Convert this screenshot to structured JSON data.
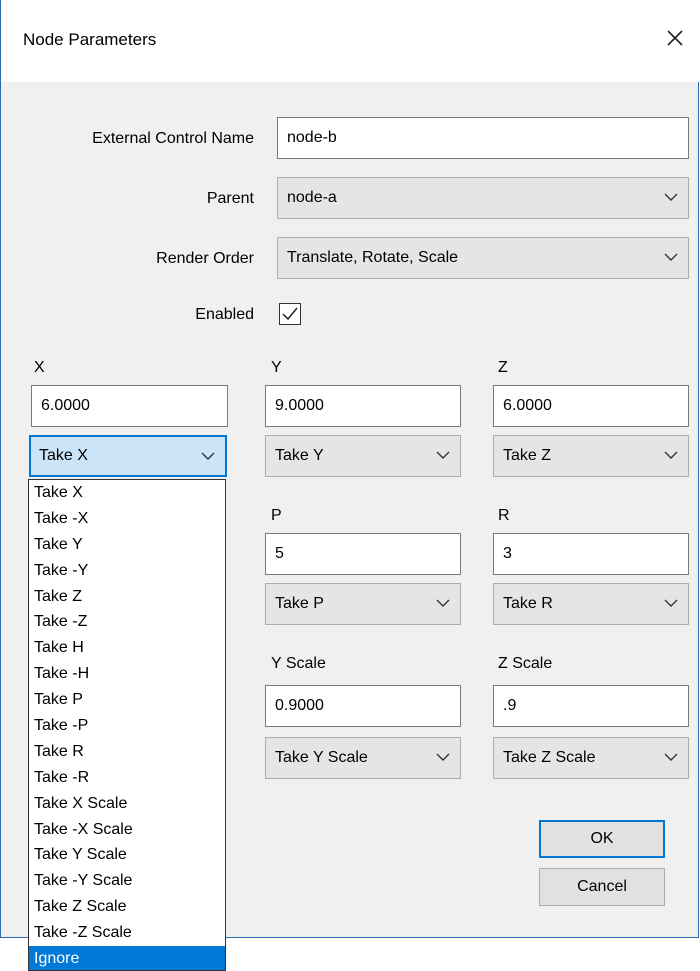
{
  "dialog": {
    "title": "Node Parameters",
    "close_icon": "close-icon"
  },
  "form": {
    "external_control_name": {
      "label": "External Control Name",
      "value": "node-b"
    },
    "parent": {
      "label": "Parent",
      "value": "node-a"
    },
    "render_order": {
      "label": "Render Order",
      "value": "Translate, Rotate, Scale"
    },
    "enabled": {
      "label": "Enabled",
      "checked": true
    }
  },
  "fields": {
    "x": {
      "label": "X",
      "value": "6.0000",
      "take": "Take X"
    },
    "y": {
      "label": "Y",
      "value": "9.0000",
      "take": "Take Y"
    },
    "z": {
      "label": "Z",
      "value": "6.0000",
      "take": "Take Z"
    },
    "p": {
      "label": "P",
      "value": "5",
      "take": "Take P"
    },
    "r": {
      "label": "R",
      "value": "3",
      "take": "Take R"
    },
    "y_scale": {
      "label": "Y Scale",
      "value": "0.9000",
      "take": "Take Y Scale"
    },
    "z_scale": {
      "label": "Z Scale",
      "value": ".9",
      "take": "Take Z Scale"
    }
  },
  "dropdown": {
    "options": [
      "Take X",
      "Take -X",
      "Take Y",
      "Take -Y",
      "Take Z",
      "Take -Z",
      "Take H",
      "Take -H",
      "Take P",
      "Take -P",
      "Take R",
      "Take -R",
      "Take X Scale",
      "Take -X Scale",
      "Take Y Scale",
      "Take -Y Scale",
      "Take Z Scale",
      "Take -Z Scale",
      "Ignore"
    ],
    "highlighted": "Ignore"
  },
  "buttons": {
    "ok": "OK",
    "cancel": "Cancel"
  }
}
